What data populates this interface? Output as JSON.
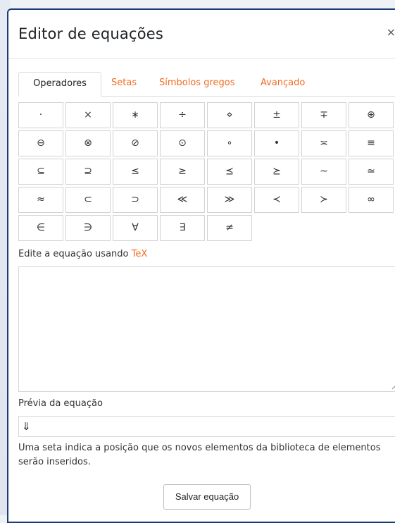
{
  "dialog": {
    "title": "Editor de equações",
    "close_glyph": "×"
  },
  "tabs": [
    {
      "label": "Operadores",
      "active": true
    },
    {
      "label": "Setas",
      "active": false
    },
    {
      "label": "Símbolos gregos",
      "active": false
    },
    {
      "label": "Avançado",
      "active": false
    }
  ],
  "operators": [
    [
      "·",
      "×",
      "∗",
      "÷",
      "⋄",
      "±",
      "∓",
      "⊕"
    ],
    [
      "⊖",
      "⊗",
      "⊘",
      "⊙",
      "∘",
      "•",
      "≍",
      "≡"
    ],
    [
      "⊆",
      "⊇",
      "≤",
      "≥",
      "⪯",
      "⪰",
      "∼",
      "≃"
    ],
    [
      "≈",
      "⊂",
      "⊃",
      "≪",
      "≫",
      "≺",
      "≻",
      "∞"
    ],
    [
      "∈",
      "∋",
      "∀",
      "∃",
      "≠"
    ]
  ],
  "editor": {
    "label_prefix": "Edite a equação usando ",
    "label_link": "TeX",
    "value": ""
  },
  "preview": {
    "label": "Prévia da equação",
    "value": "⇓"
  },
  "help_text": "Uma seta indica a posição que os novos elementos da biblioteca de elementos serão inseridos.",
  "save_label": "Salvar equação",
  "colors": {
    "accent": "#f26b21",
    "border": "#1c3a73"
  }
}
